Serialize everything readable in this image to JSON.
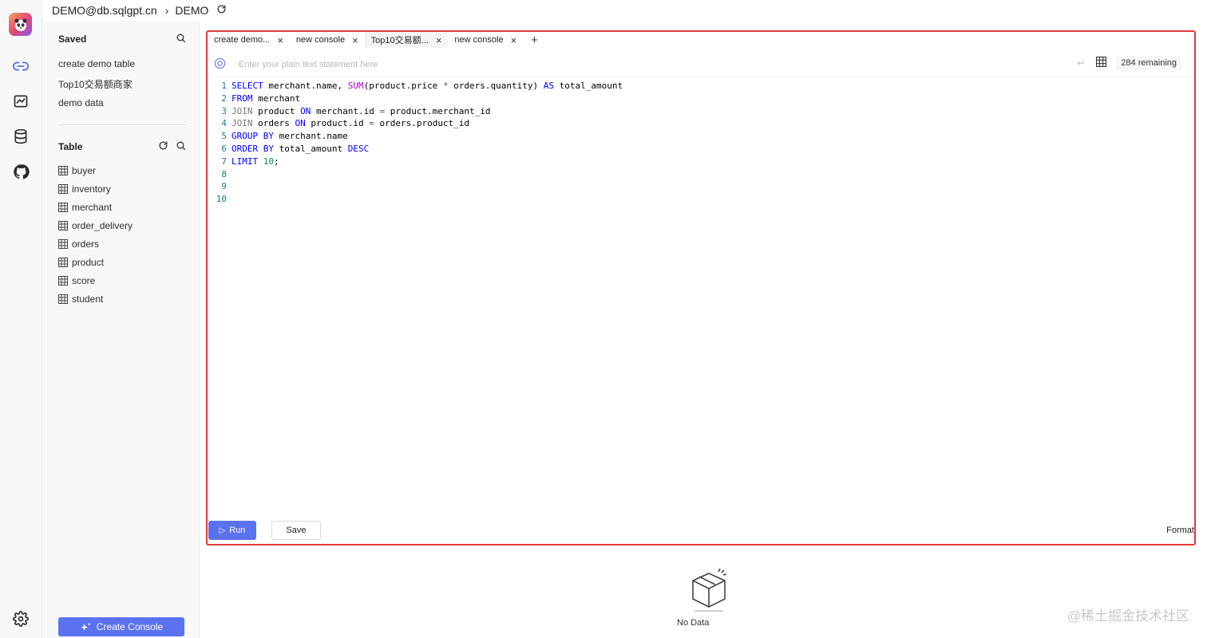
{
  "topbar": {
    "connection": "DEMO@db.sqlgpt.cn",
    "separator": "›",
    "database": "DEMO"
  },
  "rail": {
    "items": [
      "link-icon",
      "dashboard-icon",
      "database-icon",
      "github-icon"
    ],
    "settings": "gear-icon"
  },
  "sidebar": {
    "saved_title": "Saved",
    "saved_items": [
      "create demo table",
      "Top10交易额商家",
      "demo data"
    ],
    "table_title": "Table",
    "tables": [
      "buyer",
      "inventory",
      "merchant",
      "order_delivery",
      "orders",
      "product",
      "score",
      "student"
    ],
    "create_console": "Create Console"
  },
  "tabs": [
    {
      "label": "create demo...",
      "active": false
    },
    {
      "label": "new console",
      "active": false
    },
    {
      "label": "Top10交易额...",
      "active": true
    },
    {
      "label": "new console",
      "active": false
    }
  ],
  "tab_close": "×",
  "tab_add": "+",
  "prompt": {
    "placeholder": "Enter your plain text statement here",
    "remaining": "284 remaining"
  },
  "code": {
    "line_numbers": [
      "1",
      "2",
      "3",
      "4",
      "5",
      "6",
      "7",
      "8",
      "9",
      "10"
    ],
    "l1": {
      "kw1": "SELECT",
      "t1": " merchant.name, ",
      "fn": "SUM",
      "t2": "(product.price ",
      "op": "*",
      "t3": " orders.quantity) ",
      "kw2": "AS",
      "t4": " total_amount"
    },
    "l2": {
      "kw": "FROM",
      "t": " merchant"
    },
    "l3": {
      "kw": "JOIN",
      "t1": " product ",
      "kw2": "ON",
      "t2": " merchant.id ",
      "op": "=",
      "t3": " product.merchant_id"
    },
    "l4": {
      "kw": "JOIN",
      "t1": " orders ",
      "kw2": "ON",
      "t2": " product.id ",
      "op": "=",
      "t3": " orders.product_id"
    },
    "l5": {
      "kw": "GROUP BY",
      "t": " merchant.name"
    },
    "l6": {
      "kw": "ORDER BY",
      "t": " total_amount ",
      "kw2": "DESC"
    },
    "l7": {
      "kw": "LIMIT",
      "t": " ",
      "num": "10",
      "t2": ";"
    }
  },
  "actions": {
    "run": "Run",
    "save": "Save",
    "format": "Format"
  },
  "results": {
    "empty": "No Data"
  },
  "watermark": "@稀土掘金技术社区"
}
